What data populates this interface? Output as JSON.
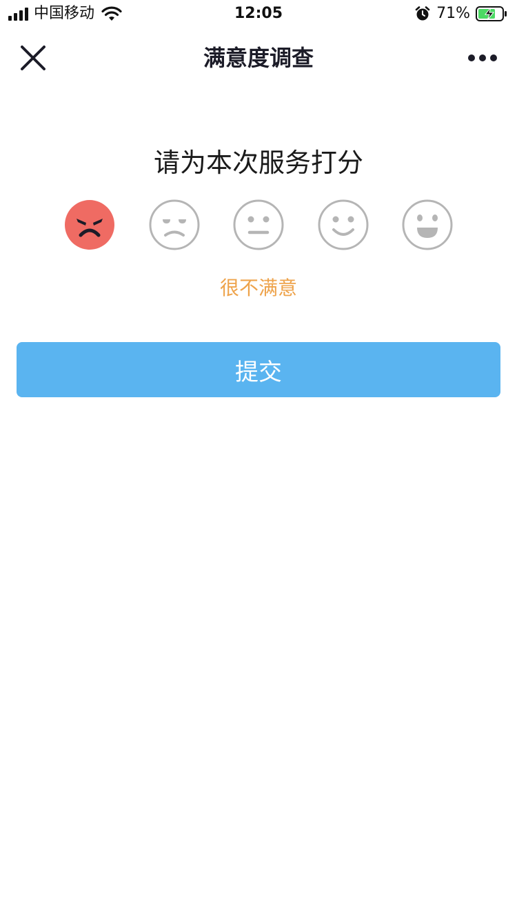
{
  "status_bar": {
    "carrier": "中国移动",
    "time": "12:05",
    "battery": "71%"
  },
  "nav": {
    "title": "满意度调查",
    "close_icon": "close-icon",
    "more_icon": "more-icon"
  },
  "survey": {
    "question": "请为本次服务打分",
    "selected_label": "很不满意",
    "selected_index": 0,
    "faces": [
      "angry-face-icon",
      "unhappy-face-icon",
      "neutral-face-icon",
      "smile-face-icon",
      "happy-face-icon"
    ]
  },
  "submit": {
    "label": "提交"
  },
  "colors": {
    "selected_face": "#ef6b63",
    "face_outline": "#b5b5b5",
    "label": "#eea34b",
    "button": "#5ab4f0"
  }
}
